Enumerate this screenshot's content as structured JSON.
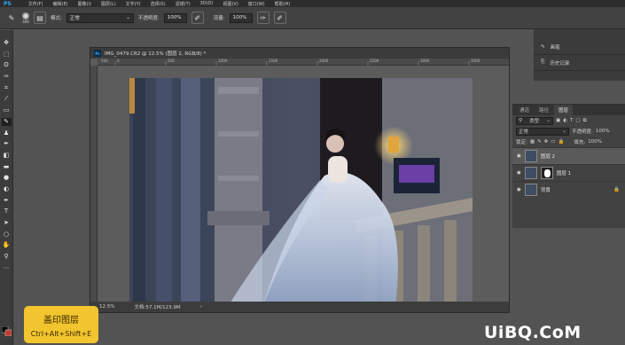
{
  "app": {
    "logo": "PS"
  },
  "menu": [
    "文件(F)",
    "编辑(E)",
    "图像(I)",
    "图层(L)",
    "文字(Y)",
    "选择(S)",
    "滤镜(T)",
    "3D(D)",
    "视图(V)",
    "窗口(W)",
    "帮助(H)"
  ],
  "options": {
    "brush_size": "300",
    "mode_label": "模式:",
    "mode_value": "正常",
    "opacity_label": "不透明度:",
    "opacity_value": "100%",
    "flow_label": "流量:",
    "flow_value": "100%"
  },
  "document": {
    "title": "IMG_0479.CR2 @ 12.5% (图层 2, RGB/8) *",
    "ruler_ticks": [
      "500",
      "0",
      "500",
      "1000",
      "1500",
      "2000",
      "2500",
      "3000",
      "3500"
    ],
    "zoom": "12.5%",
    "doc_size": "文档:57.1M/123.9M"
  },
  "history_panel": {
    "items": [
      "画笔",
      "历史记录"
    ]
  },
  "layers_panel": {
    "tabs": [
      "通道",
      "路径",
      "图层"
    ],
    "active_tab": "图层",
    "filter_label": "类型",
    "blend_mode": "正常",
    "opacity_label": "不透明度:",
    "opacity_value": "100%",
    "lock_label": "锁定:",
    "fill_label": "填充:",
    "fill_value": "100%",
    "layers": [
      {
        "name": "图层 2",
        "selected": true,
        "mask": false
      },
      {
        "name": "图层 1",
        "selected": false,
        "mask": true
      },
      {
        "name": "背景",
        "selected": false,
        "mask": false
      }
    ]
  },
  "tooltip": {
    "title": "盖印图层",
    "shortcut": "Ctrl+Alt+Shift+E"
  },
  "watermark": "UiBQ.CoM"
}
